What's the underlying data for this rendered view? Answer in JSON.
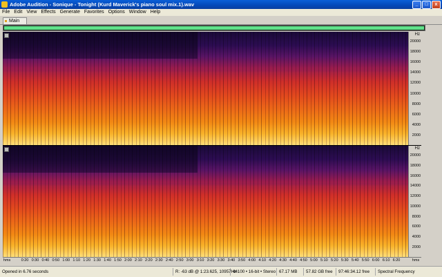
{
  "window": {
    "title": "Adobe Audition - Sonique - Tonight (Kurd Maverick's piano soul mix.1).wav",
    "minimize_glyph": "_",
    "maximize_glyph": "□",
    "close_glyph": "x"
  },
  "menu": [
    "File",
    "Edit",
    "View",
    "Effects",
    "Generate",
    "Favorites",
    "Options",
    "Window",
    "Help"
  ],
  "tab": {
    "label": "Main"
  },
  "overview": {
    "visible_fraction": 1.0,
    "color": "#5fe08a"
  },
  "freq_ruler": {
    "unit": "Hz",
    "ticks": [
      "20000",
      "18000",
      "16000",
      "14000",
      "12000",
      "10000",
      "8000",
      "6000",
      "4000",
      "2000"
    ]
  },
  "time_ruler": {
    "start": "hms",
    "labels": [
      "0:20",
      "0:30",
      "0:40",
      "0:50",
      "1:00",
      "1:10",
      "1:20",
      "1:30",
      "1:40",
      "1:50",
      "2:00",
      "2:10",
      "2:20",
      "2:30",
      "2:40",
      "2:50",
      "3:00",
      "3:10",
      "3:20",
      "3:30",
      "3:40",
      "3:50",
      "4:00",
      "4:10",
      "4:20",
      "4:30",
      "4:40",
      "4:50",
      "5:00",
      "5:10",
      "5:20",
      "5:30",
      "5:40",
      "5:50",
      "6:00",
      "6:10",
      "6:20"
    ],
    "end": "hms"
  },
  "status": {
    "opened": "Opened in 6.76 seconds",
    "level": "R: -63 dB @  1:23.625, 10957Hz",
    "format": "44100 • 16-bit • Stereo",
    "size": "67.17 MB",
    "free": "57.82 GB free",
    "free_time": "97:46:34.12 free",
    "view_mode": "Spectral Frequency"
  },
  "colors": {
    "titlebar": "#0a5fd8",
    "spectrum_low": "#1a0a38",
    "spectrum_high": "#ffe07a"
  }
}
